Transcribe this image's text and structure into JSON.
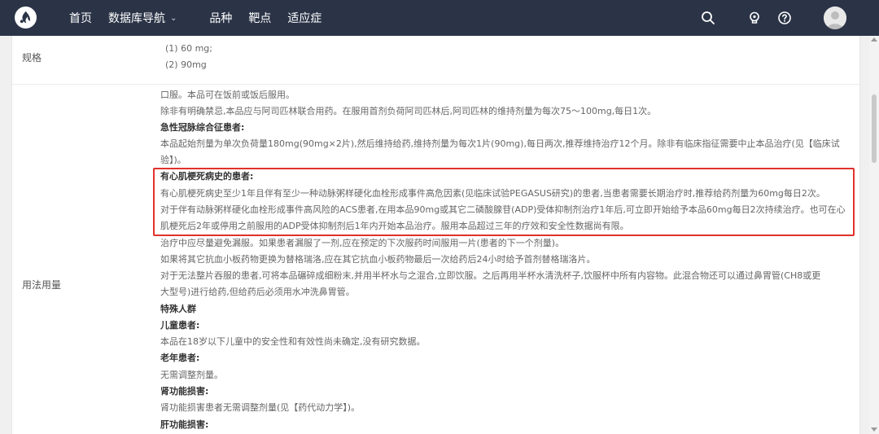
{
  "nav": {
    "logo_icon": "flame-logo-icon",
    "items": [
      {
        "label": "首页"
      },
      {
        "label": "数据库导航",
        "has_dropdown": true
      },
      {
        "label": "品种"
      },
      {
        "label": "靶点"
      },
      {
        "label": "适应症"
      }
    ],
    "icons": [
      "search-icon",
      "lightbulb-icon",
      "help-icon",
      "avatar"
    ]
  },
  "spec": {
    "label": "规格",
    "items": [
      "(1) 60 mg;",
      "(2) 90mg"
    ]
  },
  "usage": {
    "label": "用法用量",
    "lines": [
      {
        "text": "口服。本品可在饭前或饭后服用。",
        "bold": false
      },
      {
        "text": "除非有明确禁忌,本品应与阿司匹林联合用药。在服用首剂负荷阿司匹林后,阿司匹林的维持剂量为每次75～100mg,每日1次。",
        "bold": false
      },
      {
        "text": "急性冠脉综合征患者:",
        "bold": true
      },
      {
        "text": "本品起始剂量为单次负荷量180mg(90mg×2片),然后维持给药,维持剂量为每次1片(90mg),每日两次,推荐维持治疗12个月。除非有临床指征需要中止本品治疗(见【临床试",
        "bold": false
      },
      {
        "text": "验】)。",
        "bold": false
      },
      {
        "text": "有心肌梗死病史的患者:",
        "bold": true
      },
      {
        "text": "有心肌梗死病史至少1年且伴有至少一种动脉粥样硬化血栓形成事件高危因素(见临床试验PEGASUS研究)的患者,当患者需要长期治疗时,推荐给药剂量为60mg每日2次。",
        "bold": false
      },
      {
        "text": "对于伴有动脉粥样硬化血栓形成事件高风险的ACS患者,在用本品90mg或其它二磷酸腺苷(ADP)受体抑制剂治疗1年后,可立即开始给予本品60mg每日2次持续治疗。也可在心",
        "bold": false
      },
      {
        "text": "肌梗死后2年或停用之前服用的ADP受体抑制剂后1年内开始本品治疗。服用本品超过三年的疗效和安全性数据尚有限。",
        "bold": false
      },
      {
        "text": "治疗中应尽量避免漏服。如果患者漏服了一剂,应在预定的下次服药时间服用一片(患者的下一个剂量)。",
        "bold": false
      },
      {
        "text": "如果将其它抗血小板药物更换为替格瑞洛,应在其它抗血小板药物最后一次给药后24小时给予首剂替格瑞洛片。",
        "bold": false
      },
      {
        "text": "对于无法整片吞服的患者,可将本品碾碎成细粉末,并用半杯水与之混合,立即饮服。之后再用半杯水清洗杯子,饮服杯中所有内容物。此混合物还可以通过鼻胃管(CH8或更",
        "bold": false
      },
      {
        "text": "大型号)进行给药,但给药后必须用水冲洗鼻胃管。",
        "bold": false
      },
      {
        "text": "特殊人群",
        "bold": true
      },
      {
        "text": "儿童患者:",
        "bold": true
      },
      {
        "text": "本品在18岁以下儿童中的安全性和有效性尚未确定,没有研究数据。",
        "bold": false
      },
      {
        "text": "老年患者:",
        "bold": true
      },
      {
        "text": "无需调整剂量。",
        "bold": false
      },
      {
        "text": "肾功能损害:",
        "bold": true
      },
      {
        "text": "肾功能损害患者无需调整剂量(见【药代动力学】)。",
        "bold": false
      },
      {
        "text": "肝功能损害:",
        "bold": true
      }
    ]
  },
  "highlight_color": "#e0322b"
}
